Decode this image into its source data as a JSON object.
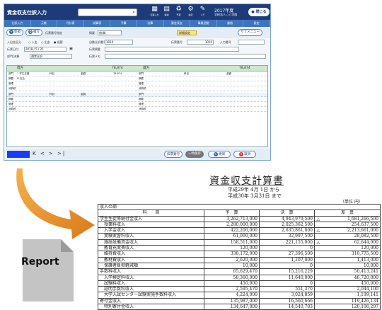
{
  "app": {
    "title": "資金収支仕訳入力",
    "search_icon_glyph": "⌕",
    "year": "2017年度",
    "org": "学校法人 ○○学園",
    "close_label": "閉じる",
    "tools": [
      {
        "glyph": "▦",
        "label": "伝票入力"
      },
      {
        "glyph": "▤",
        "label": "帳簿"
      },
      {
        "glyph": "♻",
        "label": "予算"
      },
      {
        "glyph": "⚙",
        "label": "設定"
      },
      {
        "glyph": "✎",
        "label": "メモ"
      },
      {
        "glyph": "?",
        "label": "ヘルプ"
      },
      {
        "glyph": "⋯",
        "label": "その他"
      }
    ]
  },
  "nav_tabs": [
    "仕訳入力",
    "元帳",
    "月計表",
    "試算表",
    "予算",
    "決算",
    "資金収支",
    "事業活動",
    "貸借",
    "設定"
  ],
  "toolbar": {
    "new_label": "新規",
    "copy_label": "複写",
    "memo_label": "伝票番号指定",
    "subject_label": "摘要",
    "subject_value": "借/貸",
    "yellow_btn": "詳細設定",
    "menu_label": "サブメニュー"
  },
  "form": {
    "in_out_label": "入出金区分",
    "radio_in": "入金",
    "radio_out": "出金",
    "radio_transfer": "振替",
    "auto_label": "自動仕訳番号",
    "auto_value": "1010",
    "slip_no_label": "伝票番号",
    "slip_no_value": "1010",
    "input_no_label": "入力番号",
    "date_label": "伝票日付",
    "date_value": "2018 / 5 / 25",
    "summary_label": "伝票摘要",
    "dept_label": "部門/決算",
    "dept_value": "通常仕訳",
    "memo_label": "伝票メモ"
  },
  "journal": {
    "debit_label": "借方",
    "credit_label": "貸方",
    "debit_total": "78,874",
    "credit_total": "78,874",
    "rows": [
      [
        "部門",
        "1 学生支援",
        "科目",
        "補助科目",
        "金額",
        "78,874"
      ],
      [
        "摘要",
        "FL支払",
        "",
        "",
        ""
      ],
      [
        "管理",
        "",
        "",
        "",
        ""
      ],
      [
        "消費税",
        "",
        "",
        "",
        ""
      ],
      [
        "部門",
        "",
        "科目",
        "",
        "金額",
        ""
      ],
      [
        "摘要",
        "",
        "",
        "",
        ""
      ],
      [
        "管理",
        "",
        "",
        "",
        ""
      ],
      [
        "消費税",
        "",
        "",
        "",
        ""
      ]
    ]
  },
  "bottom": {
    "nav_glyphs": "K < > >|",
    "print_label": "伝票発行",
    "save_label": "一時保存",
    "update_label": "更新",
    "cancel_label": "取消"
  },
  "doc": {
    "label": "Report"
  },
  "report": {
    "title": "資金収支計算書",
    "period_from": "平成29年 4月 1日 から",
    "period_to": "平成30年 3月31日 まで",
    "unit": "（単位 円）",
    "section": "収入の部",
    "headers": [
      "科　　目",
      "予　算",
      "決　算",
      "差　異"
    ],
    "rows": [
      [
        "学生生徒等納付金収入",
        "3,262,713,000",
        "4,943,979,500",
        "△",
        "1,681,266,500"
      ],
      [
        "　授業料収入",
        "2,280,000,000",
        "2,025,362,500",
        "",
        "254,637,500"
      ],
      [
        "　入学金収入",
        "422,200,000",
        "2,635,861,000",
        "△",
        "2,213,661,000"
      ],
      [
        "　実験実習料収入",
        "61,000,000",
        "32,997,500",
        "",
        "28,082,500"
      ],
      [
        "　施設設備資金収入",
        "158,511,000",
        "221,155,000",
        "△",
        "62,644,000"
      ],
      [
        "　教育充実費収入",
        "120,000",
        "0",
        "",
        "120,000"
      ],
      [
        "　維持費収入",
        "338,172,000",
        "27,396,500",
        "",
        "310,775,500"
      ],
      [
        "　教材費収入",
        "2,620,000",
        "1,207,000",
        "",
        "1,413,000"
      ],
      [
        "　保護者負担軽減額",
        "10,000",
        "0",
        "",
        "10,000"
      ],
      [
        "手数料収入",
        "65,629,470",
        "15,216,229",
        "",
        "50,413,241"
      ],
      [
        "　入学検定料収入",
        "58,360,000",
        "11,640,000",
        "",
        "46,720,000"
      ],
      [
        "　試験料収入",
        "450,000",
        "0",
        "",
        "450,000"
      ],
      [
        "　証明手数料収入",
        "2,595,470",
        "551,370",
        "",
        "2,044,100"
      ],
      [
        "　大学入試センター試験実施手数料収入",
        "4,224,000",
        "3,024,859",
        "",
        "1,199,141"
      ],
      [
        "寄付金収入",
        "135,987,000",
        "16,560,666",
        "",
        "119,426,134"
      ],
      [
        "　特別寄付金収入",
        "134,647,000",
        "14,540,703",
        "",
        "120,106,297"
      ]
    ]
  }
}
